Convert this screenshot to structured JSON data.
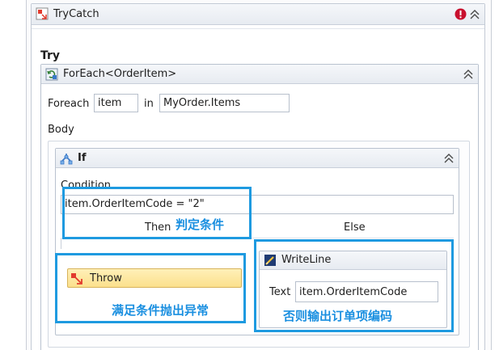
{
  "trycatch": {
    "title": "TryCatch"
  },
  "try_section": {
    "label": "Try"
  },
  "foreach": {
    "title": "ForEach<OrderItem>",
    "foreach_label": "Foreach",
    "item_value": "item",
    "in_label": "in",
    "collection_value": "MyOrder.Items",
    "body_label": "Body"
  },
  "if_activity": {
    "title": "If",
    "condition_label": "Condition",
    "condition_value": "item.OrderItemCode = \"2\"",
    "then_label": "Then",
    "else_label": "Else"
  },
  "throw_activity": {
    "title": "Throw"
  },
  "writeline": {
    "title": "WriteLine",
    "text_label": "Text",
    "text_value": "item.OrderItemCode"
  },
  "annotations": {
    "condition_note": "判定条件",
    "throw_note": "满足条件抛出异常",
    "else_note": "否则输出订单项编码"
  },
  "colors": {
    "annotation_blue": "#1e9ae0",
    "error_red": "#c8102e",
    "throw_fill": "#fbe08c"
  },
  "icons": {
    "trycatch": "trycatch-icon",
    "error": "error-icon",
    "collapse": "double-chevron-up-icon",
    "foreach": "foreach-icon",
    "if": "if-icon",
    "throw": "throw-icon",
    "writeline": "writeline-icon"
  }
}
